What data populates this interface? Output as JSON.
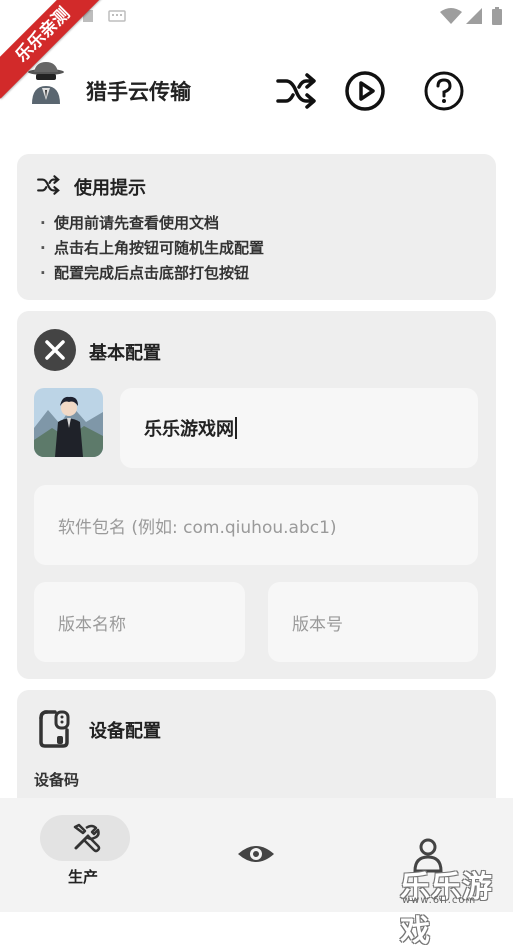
{
  "ribbon": {
    "text": "乐乐亲测"
  },
  "app": {
    "title": "猎手云传输"
  },
  "toolbar": {
    "shuffle_icon": "shuffle-icon",
    "play_icon": "play-circle-icon",
    "help_icon": "help-circle-icon"
  },
  "tips": {
    "title": "使用提示",
    "lines": [
      "使用前请先查看使用文档",
      "点击右上角按钮可随机生成配置",
      "配置完成后点击底部打包按钮"
    ]
  },
  "basic": {
    "title": "基本配置",
    "app_name_value": "乐乐游戏网",
    "package_placeholder": "软件包名 (例如: com.qiuhou.abc1)",
    "version_name_placeholder": "版本名称",
    "version_code_placeholder": "版本号"
  },
  "device": {
    "title": "设备配置",
    "code_label": "设备码"
  },
  "nav": {
    "produce_label": "生产"
  },
  "watermark": {
    "text": "乐乐游戏",
    "url": "www.6ll.com"
  },
  "colors": {
    "card": "#eeeeee",
    "ribbon": "#d22a2a",
    "accent": "#111111"
  }
}
